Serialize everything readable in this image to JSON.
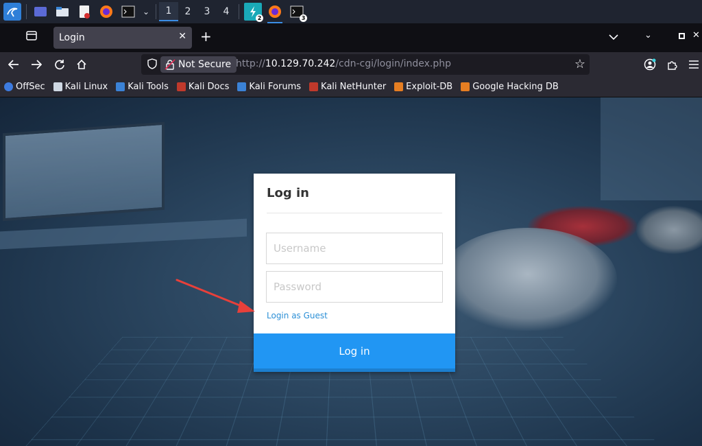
{
  "taskbar": {
    "workspaces": [
      "1",
      "2",
      "3",
      "4"
    ],
    "active_workspace": "1",
    "badges": {
      "app1": "2",
      "app3": "3"
    }
  },
  "browser": {
    "tab_title": "Login",
    "security_label": "Not Secure",
    "url_prefix": "http://",
    "url_host": "10.129.70.242",
    "url_path": "/cdn-cgi/login/index.php",
    "bookmarks": [
      {
        "label": "OffSec",
        "color": "#3d7be0"
      },
      {
        "label": "Kali Linux",
        "color": "#cfd8e3"
      },
      {
        "label": "Kali Tools",
        "color": "#3b82d6"
      },
      {
        "label": "Kali Docs",
        "color": "#c0392b"
      },
      {
        "label": "Kali Forums",
        "color": "#3b82d6"
      },
      {
        "label": "Kali NetHunter",
        "color": "#c0392b"
      },
      {
        "label": "Exploit-DB",
        "color": "#e67e22"
      },
      {
        "label": "Google Hacking DB",
        "color": "#e67e22"
      }
    ]
  },
  "login": {
    "title": "Log in",
    "username_placeholder": "Username",
    "password_placeholder": "Password",
    "guest_link": "Login as Guest",
    "submit_label": "Log in"
  },
  "colors": {
    "accent": "#2196f3",
    "link": "#2b8fd6",
    "annotation_arrow": "#e8403a"
  }
}
